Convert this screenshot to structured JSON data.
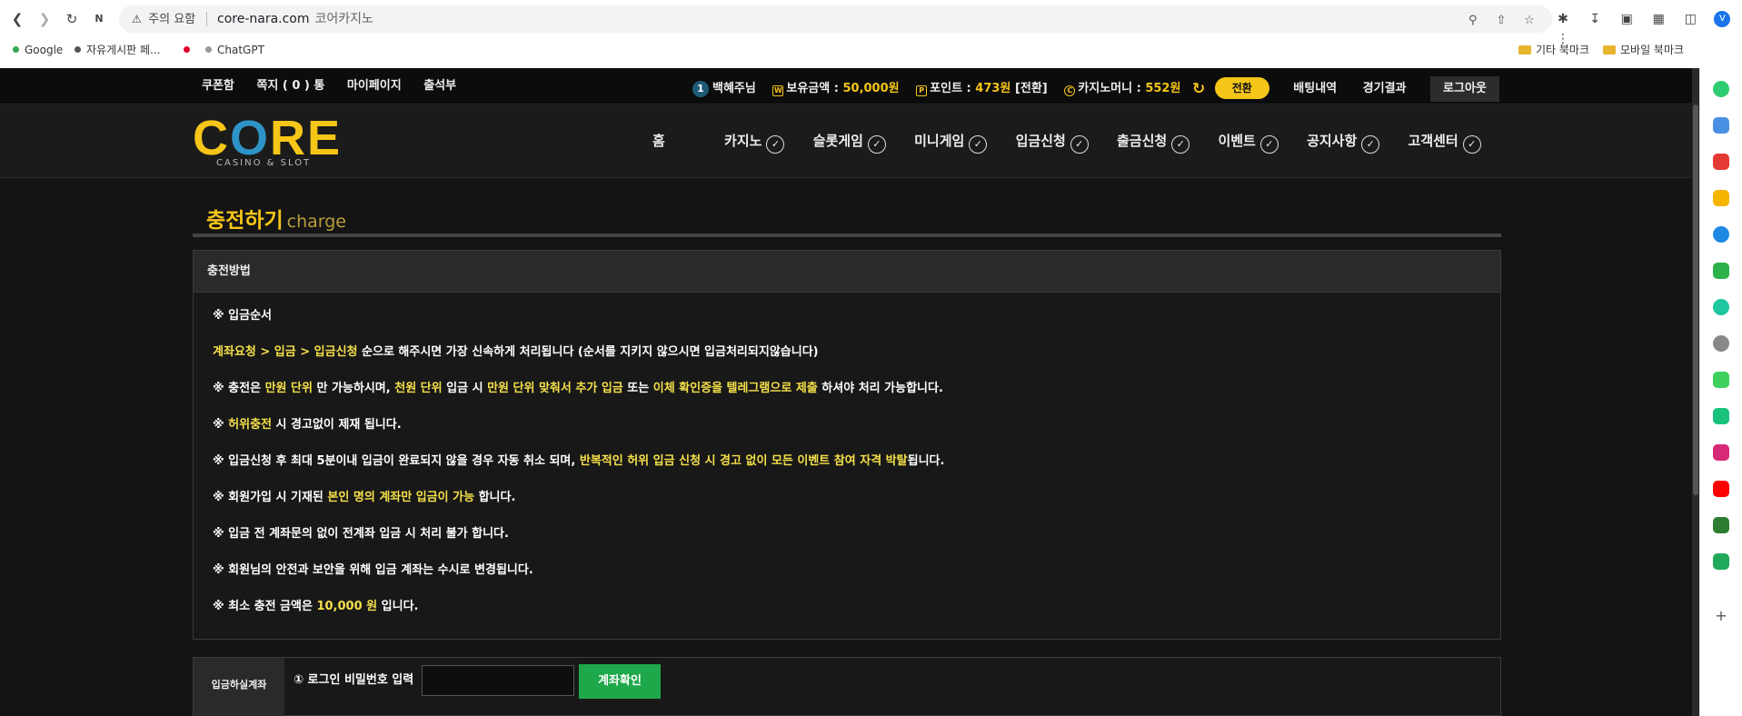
{
  "browser": {
    "security_label": "주의 요함",
    "url": "core-nara.com",
    "page_title": "코어카지노",
    "bookmarks": [
      {
        "label": "Google",
        "color": "#34a853"
      },
      {
        "label": "자유게시판 페...",
        "color": "#555555"
      },
      {
        "label": "",
        "color": "#e0002a"
      },
      {
        "label": "ChatGPT",
        "color": "#999999"
      }
    ],
    "bookmarks_right": [
      "기타 북마크",
      "모바일 북마크"
    ],
    "profile_initial": "V"
  },
  "topbar": {
    "coupon": "쿠폰함",
    "memo": "쪽지 ( 0 ) 통",
    "mypage": "마이페이지",
    "attendance": "출석부",
    "level": "1",
    "username": "백혜주님",
    "balance_label": "보유금액 :",
    "balance_value": "50,000원",
    "point_label": "포인트 :",
    "point_value": "473원",
    "point_convert": "[전환]",
    "casino_label": "카지노머니 :",
    "casino_value": "552원",
    "swap_button": "전환",
    "bet_history": "배팅내역",
    "results": "경기결과",
    "logout": "로그아웃"
  },
  "logo": {
    "text_c": "C",
    "text_o": "O",
    "text_re": "RE",
    "subtitle": "CASINO & SLOT"
  },
  "nav": {
    "home": "홈",
    "items": [
      "카지노",
      "슬롯게임",
      "미니게임",
      "입금신청",
      "출금신청",
      "이벤트",
      "공지사항",
      "고객센터"
    ]
  },
  "page": {
    "title": "충전하기",
    "title_en": "charge",
    "box_title": "충전방법",
    "line1": "※ 입금순서",
    "line2_hl": "계좌요청 > 입금 > 입금신청",
    "line2_rest": " 순으로 해주시면 가장 신속하게 처리됩니다 (순서를 지키지 않으시면 입금처리되지않습니다)",
    "line3_a": "※ 충전은 ",
    "line3_b": "만원 단위",
    "line3_c": " 만 가능하시며, ",
    "line3_d": "천원 단위",
    "line3_e": " 입금 시 ",
    "line3_f": "만원 단위 맞춰서 추가 입금",
    "line3_g": " 또는 ",
    "line3_h": "이체 확인증을 텔레그램으로 제출",
    "line3_i": " 하셔야 처리 가능합니다.",
    "line4_a": "※ ",
    "line4_b": "허위충전",
    "line4_c": " 시 경고없이 제재 됩니다.",
    "line5_a": "※ 입금신청 후 최대 5분이내 입금이 완료되지 않을 경우 자동 취소 되며, ",
    "line5_b": "반복적인 허위 입금 신청 시 경고 없이 모든 이벤트 참여 자격 박탈",
    "line5_c": "됩니다.",
    "line6_a": "※ 회원가입 시 기재된 ",
    "line6_b": "본인 명의 계좌만 입금이 가능",
    "line6_c": " 합니다.",
    "line7": "※ 입금 전 계좌문의 없이 전계좌 입금 시 처리 불가 합니다.",
    "line8": "※ 회원님의 안전과 보안을 위해 입금 계좌는 수시로 변경됩니다.",
    "line9_a": "※ 최소 충전 금액은 ",
    "line9_b": "10,000 원",
    "line9_c": " 입니다.",
    "deposit_label": "입금하실계좌",
    "deposit_step": "① 로그인 비밀번호 입력",
    "deposit_button": "계좌확인"
  },
  "colors": {
    "accent": "#f5c518",
    "highlight": "#f5e04a",
    "confirm_button": "#1ea84a"
  }
}
